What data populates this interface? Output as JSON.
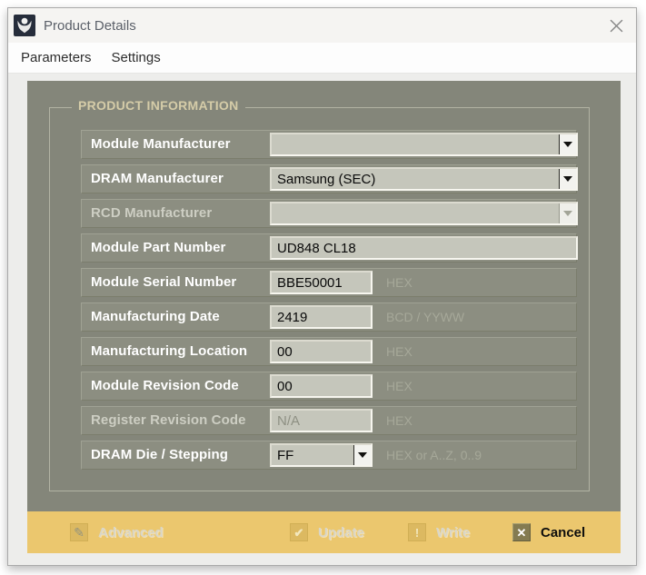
{
  "window": {
    "title": "Product Details"
  },
  "menu": {
    "items": [
      {
        "label": "Parameters"
      },
      {
        "label": "Settings"
      }
    ]
  },
  "group": {
    "title": "PRODUCT INFORMATION"
  },
  "fields": [
    {
      "label": "Module Manufacturer",
      "type": "combo",
      "value": "",
      "hint": "",
      "disabled": false
    },
    {
      "label": "DRAM Manufacturer",
      "type": "combo",
      "value": "Samsung (SEC)",
      "hint": "",
      "disabled": false
    },
    {
      "label": "RCD Manufacturer",
      "type": "combo",
      "value": "",
      "hint": "",
      "disabled": true
    },
    {
      "label": "Module Part Number",
      "type": "text-wide",
      "value": "UD848 CL18",
      "hint": "",
      "disabled": false
    },
    {
      "label": "Module Serial Number",
      "type": "text",
      "value": "BBE50001",
      "hint": "HEX",
      "disabled": false
    },
    {
      "label": "Manufacturing Date",
      "type": "text",
      "value": "2419",
      "hint": "BCD / YYWW",
      "disabled": false
    },
    {
      "label": "Manufacturing Location",
      "type": "text",
      "value": "00",
      "hint": "HEX",
      "disabled": false
    },
    {
      "label": "Module Revision Code",
      "type": "text",
      "value": "00",
      "hint": "HEX",
      "disabled": false
    },
    {
      "label": "Register Revision Code",
      "type": "text",
      "value": "N/A",
      "hint": "HEX",
      "disabled": true
    },
    {
      "label": "DRAM Die / Stepping",
      "type": "combo-small",
      "value": "FF",
      "hint": "HEX or A..Z, 0..9",
      "disabled": false
    }
  ],
  "footer": {
    "buttons": [
      {
        "label": "Advanced",
        "icon": "pencil-icon",
        "glyph": "✎",
        "enabled": false
      },
      {
        "label": "Update",
        "icon": "checkmark-icon",
        "glyph": "✔",
        "enabled": false
      },
      {
        "label": "Write",
        "icon": "exclamation-icon",
        "glyph": "!",
        "enabled": false
      },
      {
        "label": "Cancel",
        "icon": "close-x-icon",
        "glyph": "✕",
        "enabled": true
      }
    ]
  },
  "colors": {
    "panel": "#84867a",
    "row_strip": "#8c8e81",
    "footer_bar": "#ebc76e",
    "group_title": "#d5cca8",
    "input_bg": "#c5c6bb",
    "hint_text": "#a6a899"
  }
}
